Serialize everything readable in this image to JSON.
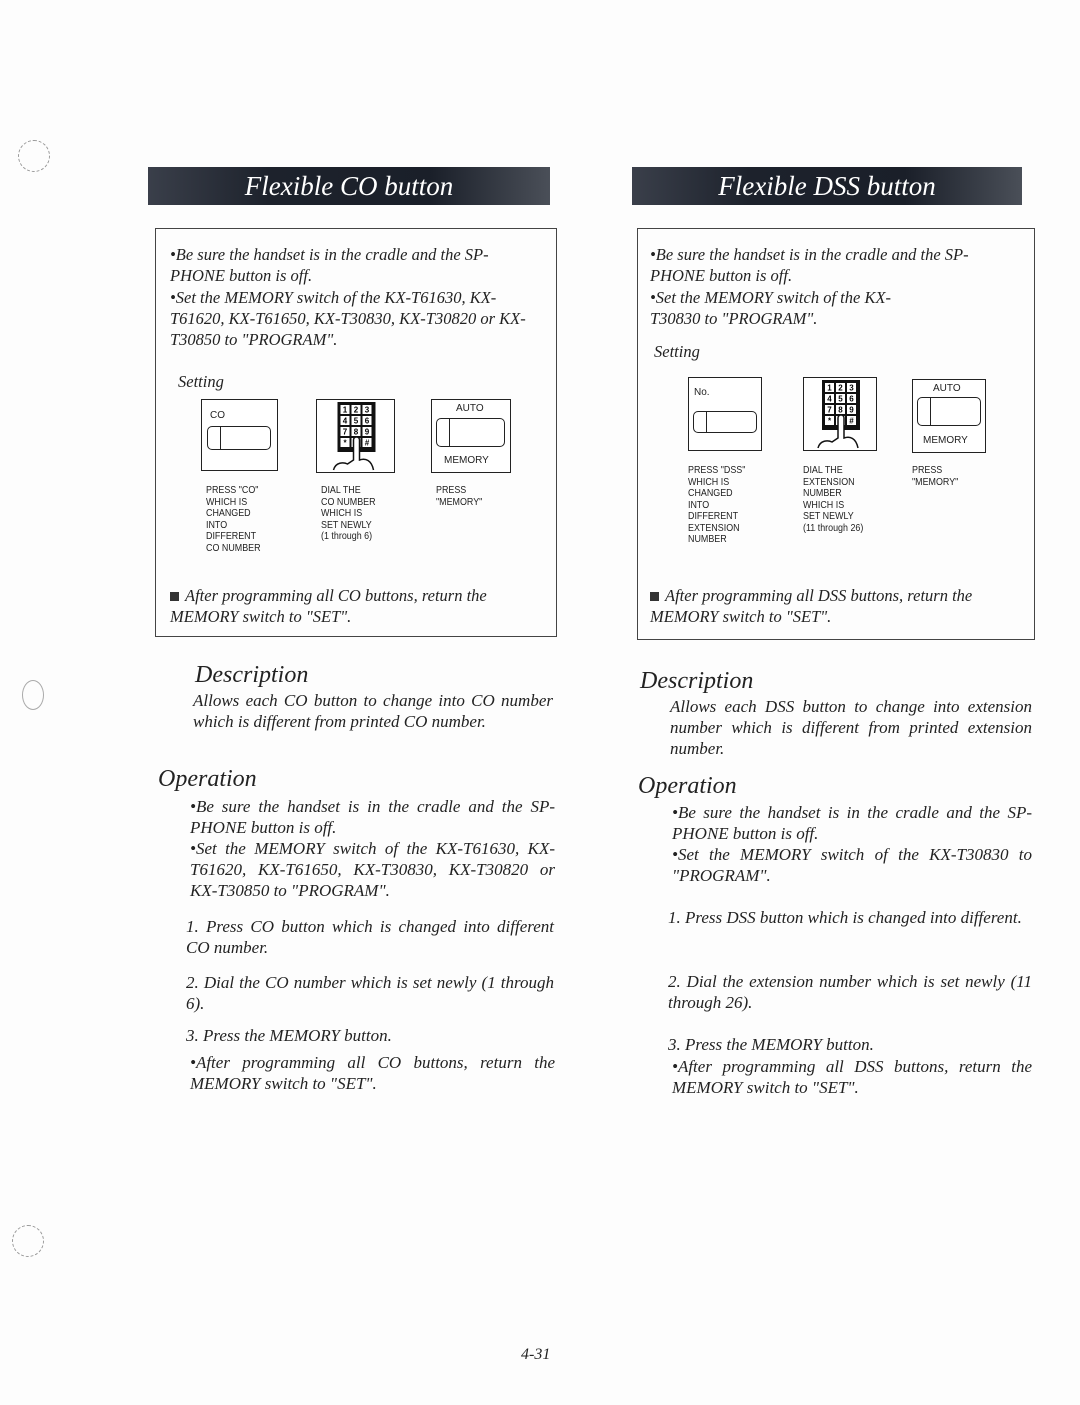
{
  "left": {
    "banner": "Flexible CO button",
    "box_bullets": [
      "•Be sure the handset is in the cradle and the SP-PHONE button is off.",
      "•Set the MEMORY switch of the KX-T61630, KX-T61620, KX-T61650, KX-T30830, KX-T30820 or KX-T30850 to \"PROGRAM\"."
    ],
    "setting": "Setting",
    "pic1_label": "CO",
    "auto": "AUTO",
    "memory": "MEMORY",
    "captions": [
      "PRESS \"CO\"\nWHICH IS\nCHANGED\nINTO\nDIFFERENT\nCO NUMBER",
      "DIAL THE\nCO NUMBER\nWHICH IS\nSET NEWLY\n(1 through 6)",
      "PRESS\n\"MEMORY\""
    ],
    "after": "After programming all CO buttons, return the MEMORY switch to \"SET\".",
    "description_heading": "Description",
    "description": "Allows each CO button to change into CO number which is different from printed CO number.",
    "operation_heading": "Operation",
    "op_bullets": [
      "•Be sure the handset is in the cradle and the SP-PHONE button is off.",
      "•Set the MEMORY switch of the KX-T61630, KX-T61620, KX-T61650, KX-T30830, KX-T30820 or KX-T30850 to \"PROGRAM\"."
    ],
    "steps": [
      "1. Press CO button which is changed into different CO number.",
      "2. Dial the CO number which is set newly (1 through 6).",
      "3. Press the MEMORY button."
    ],
    "op_after": "•After programming all CO buttons, return the MEMORY switch to \"SET\"."
  },
  "right": {
    "banner": "Flexible DSS button",
    "box_bullets": [
      "•Be sure the handset is in the cradle and the SP-PHONE button is off.",
      "•Set the MEMORY switch of the KX-T30830 to \"PROGRAM\"."
    ],
    "setting": "Setting",
    "pic1_label": "No.",
    "auto": "AUTO",
    "memory": "MEMORY",
    "captions": [
      "PRESS \"DSS\"\nWHICH IS\nCHANGED\nINTO\nDIFFERENT\nEXTENSION\nNUMBER",
      "DIAL THE\nEXTENSION\nNUMBER\nWHICH IS\nSET NEWLY\n(11 through 26)",
      "PRESS\n\"MEMORY\""
    ],
    "after": "After programming all DSS buttons, return the MEMORY switch to \"SET\".",
    "description_heading": "Description",
    "description": "Allows each DSS button to change into extension number which is different from printed extension number.",
    "operation_heading": "Operation",
    "op_bullets": [
      "•Be sure the handset is in the cradle and the SP-PHONE button is off.",
      "•Set the MEMORY switch of the KX-T30830 to \"PROGRAM\"."
    ],
    "steps": [
      "1. Press DSS button which is changed into different.",
      "2. Dial the extension number which is set newly (11 through 26).",
      "3. Press the MEMORY button."
    ],
    "op_after": "•After programming all DSS buttons, return the MEMORY switch to \"SET\"."
  },
  "keypad_keys": [
    "1",
    "2",
    "3",
    "4",
    "5",
    "6",
    "7",
    "8",
    "9",
    "*",
    "0",
    "#"
  ],
  "page_number": "4-31"
}
